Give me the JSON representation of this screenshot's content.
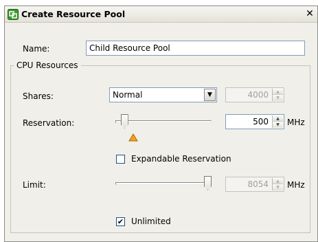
{
  "dialog": {
    "title": "Create Resource Pool",
    "close_glyph": "✕",
    "icon": "resource-pool-icon"
  },
  "name": {
    "label": "Name:",
    "value": "Child Resource Pool"
  },
  "cpu": {
    "group_label": "CPU Resources",
    "shares": {
      "label": "Shares:",
      "selected": "Normal",
      "value": "4000"
    },
    "reservation": {
      "label": "Reservation:",
      "value": "500",
      "unit": "MHz",
      "slider_fraction": 0.06
    },
    "expandable": {
      "label": "Expandable Reservation",
      "checked": false
    },
    "limit": {
      "label": "Limit:",
      "value": "8054",
      "unit": "MHz",
      "slider_fraction": 1.0
    },
    "unlimited": {
      "label": "Unlimited",
      "checked": true
    }
  },
  "colors": {
    "dialog_bg": "#f0efe9",
    "warning": "#f0a020",
    "field_border": "#7f9db9"
  }
}
